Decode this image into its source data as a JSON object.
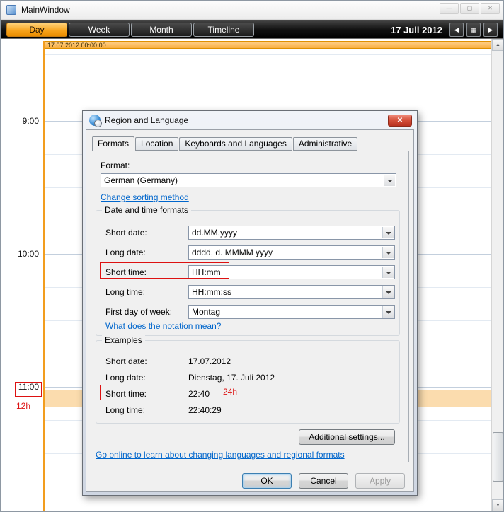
{
  "colors": {
    "accent_orange": "#f6a118",
    "highlight_band": "#fbdcae",
    "annotation_red": "#dd1111",
    "link_blue": "#0066cc"
  },
  "window": {
    "title": "MainWindow"
  },
  "icons": {
    "minimize": "—",
    "maximize": "▢",
    "close": "✕",
    "prev": "◀",
    "grid": "▦",
    "next": "▶",
    "scroll_up": "▲",
    "scroll_down": "▼",
    "dialog_close": "✕"
  },
  "toolbar": {
    "tabs": [
      {
        "label": "Day"
      },
      {
        "label": "Week"
      },
      {
        "label": "Month"
      },
      {
        "label": "Timeline"
      }
    ],
    "date_label": "17 Juli 2012"
  },
  "calendar": {
    "day_header": "17.07.2012 00:00:00",
    "time_labels": [
      "9:00",
      "10:00",
      "11:00"
    ]
  },
  "annotations": {
    "gutter_label": "12h",
    "example_label": "24h"
  },
  "dialog": {
    "title": "Region and Language",
    "tabs": [
      {
        "label": "Formats"
      },
      {
        "label": "Location"
      },
      {
        "label": "Keyboards and Languages"
      },
      {
        "label": "Administrative"
      }
    ],
    "format_label": "Format:",
    "format_value": "German (Germany)",
    "change_sorting_link": "Change sorting method",
    "datetime_group": {
      "title": "Date and time formats",
      "rows": [
        {
          "label": "Short date:",
          "value": "dd.MM.yyyy"
        },
        {
          "label": "Long date:",
          "value": "dddd, d. MMMM yyyy"
        },
        {
          "label": "Short time:",
          "value": "HH:mm"
        },
        {
          "label": "Long time:",
          "value": "HH:mm:ss"
        },
        {
          "label": "First day of week:",
          "value": "Montag"
        }
      ],
      "notation_link": "What does the notation mean?"
    },
    "examples_group": {
      "title": "Examples",
      "rows": [
        {
          "label": "Short date:",
          "value": "17.07.2012"
        },
        {
          "label": "Long date:",
          "value": "Dienstag, 17. Juli 2012"
        },
        {
          "label": "Short time:",
          "value": "22:40"
        },
        {
          "label": "Long time:",
          "value": "22:40:29"
        }
      ]
    },
    "additional_settings_button": "Additional settings...",
    "online_link": "Go online to learn about changing languages and regional formats",
    "buttons": {
      "ok": "OK",
      "cancel": "Cancel",
      "apply": "Apply"
    }
  }
}
